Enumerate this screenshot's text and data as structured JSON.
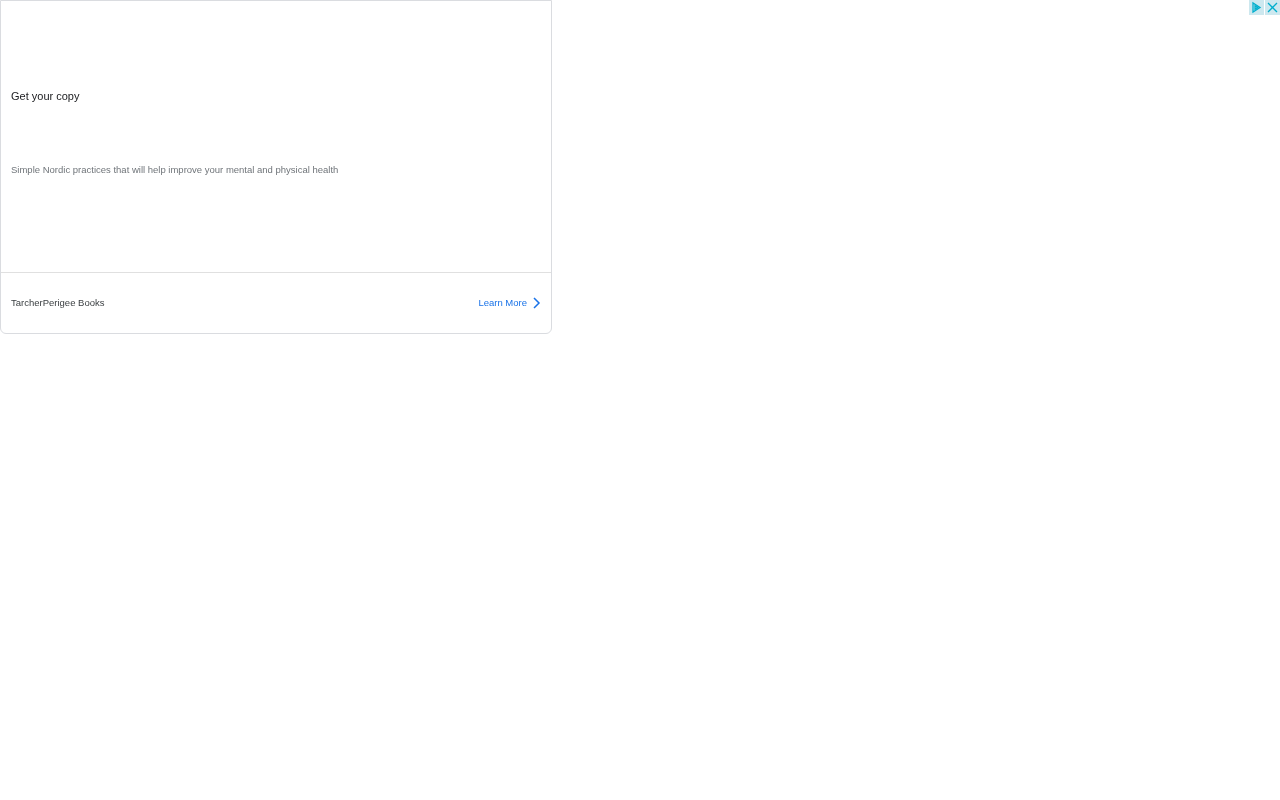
{
  "ad": {
    "headline": "Get your copy",
    "description": "Simple Nordic practices that will help improve your mental and physical health",
    "advertiser": "TarcherPerigee Books",
    "cta": "Learn More"
  }
}
